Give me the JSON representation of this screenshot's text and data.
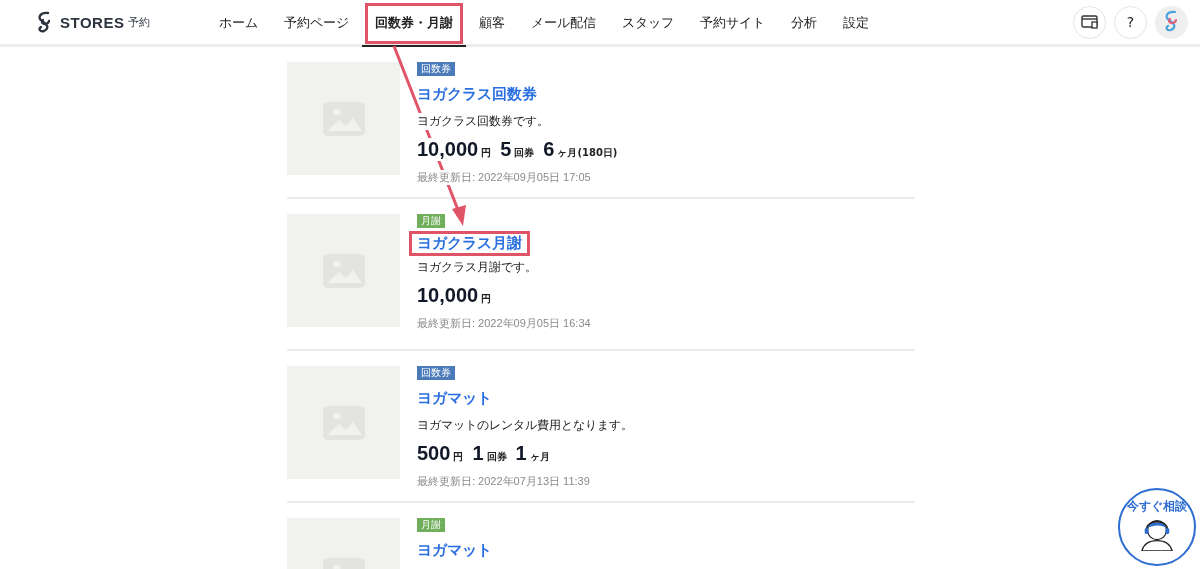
{
  "header": {
    "logo_text": "STORES",
    "logo_suffix": "予約",
    "nav": [
      {
        "label": "ホーム",
        "selected": false,
        "highlighted": false
      },
      {
        "label": "予約ページ",
        "selected": false,
        "highlighted": false
      },
      {
        "label": "回数券・月謝",
        "selected": true,
        "highlighted": true
      },
      {
        "label": "顧客",
        "selected": false,
        "highlighted": false
      },
      {
        "label": "メール配信",
        "selected": false,
        "highlighted": false
      },
      {
        "label": "スタッフ",
        "selected": false,
        "highlighted": false
      },
      {
        "label": "予約サイト",
        "selected": false,
        "highlighted": false
      },
      {
        "label": "分析",
        "selected": false,
        "highlighted": false
      },
      {
        "label": "設定",
        "selected": false,
        "highlighted": false
      }
    ],
    "help_label": "?"
  },
  "items": [
    {
      "tag": "回数券",
      "color": "#4a7ab8",
      "title": "ヨガクラス回数券",
      "title_highlighted": false,
      "description": "ヨガクラス回数券です。",
      "price": [
        {
          "value": "10,000",
          "unit": "円"
        },
        {
          "value": "5",
          "unit": "回券"
        },
        {
          "value": "6",
          "unit": "ヶ月(180日)"
        }
      ],
      "updated": "最終更新日: 2022年09月05日 17:05"
    },
    {
      "tag": "月謝",
      "color": "#6fae5a",
      "title": "ヨガクラス月謝",
      "title_highlighted": true,
      "description": "ヨガクラス月謝です。",
      "price": [
        {
          "value": "10,000",
          "unit": "円"
        }
      ],
      "updated": "最終更新日: 2022年09月05日 16:34"
    },
    {
      "tag": "回数券",
      "color": "#4a7ab8",
      "title": "ヨガマット",
      "title_highlighted": false,
      "description": "ヨガマットのレンタル費用となります。",
      "price": [
        {
          "value": "500",
          "unit": "円"
        },
        {
          "value": "1",
          "unit": "回券"
        },
        {
          "value": "1",
          "unit": "ヶ月"
        }
      ],
      "updated": "最終更新日: 2022年07月13日 11:39"
    },
    {
      "tag": "月謝",
      "color": "#6fae5a",
      "title": "ヨガマット",
      "title_highlighted": false
    }
  ],
  "chat": {
    "label": "今すぐ相談"
  }
}
